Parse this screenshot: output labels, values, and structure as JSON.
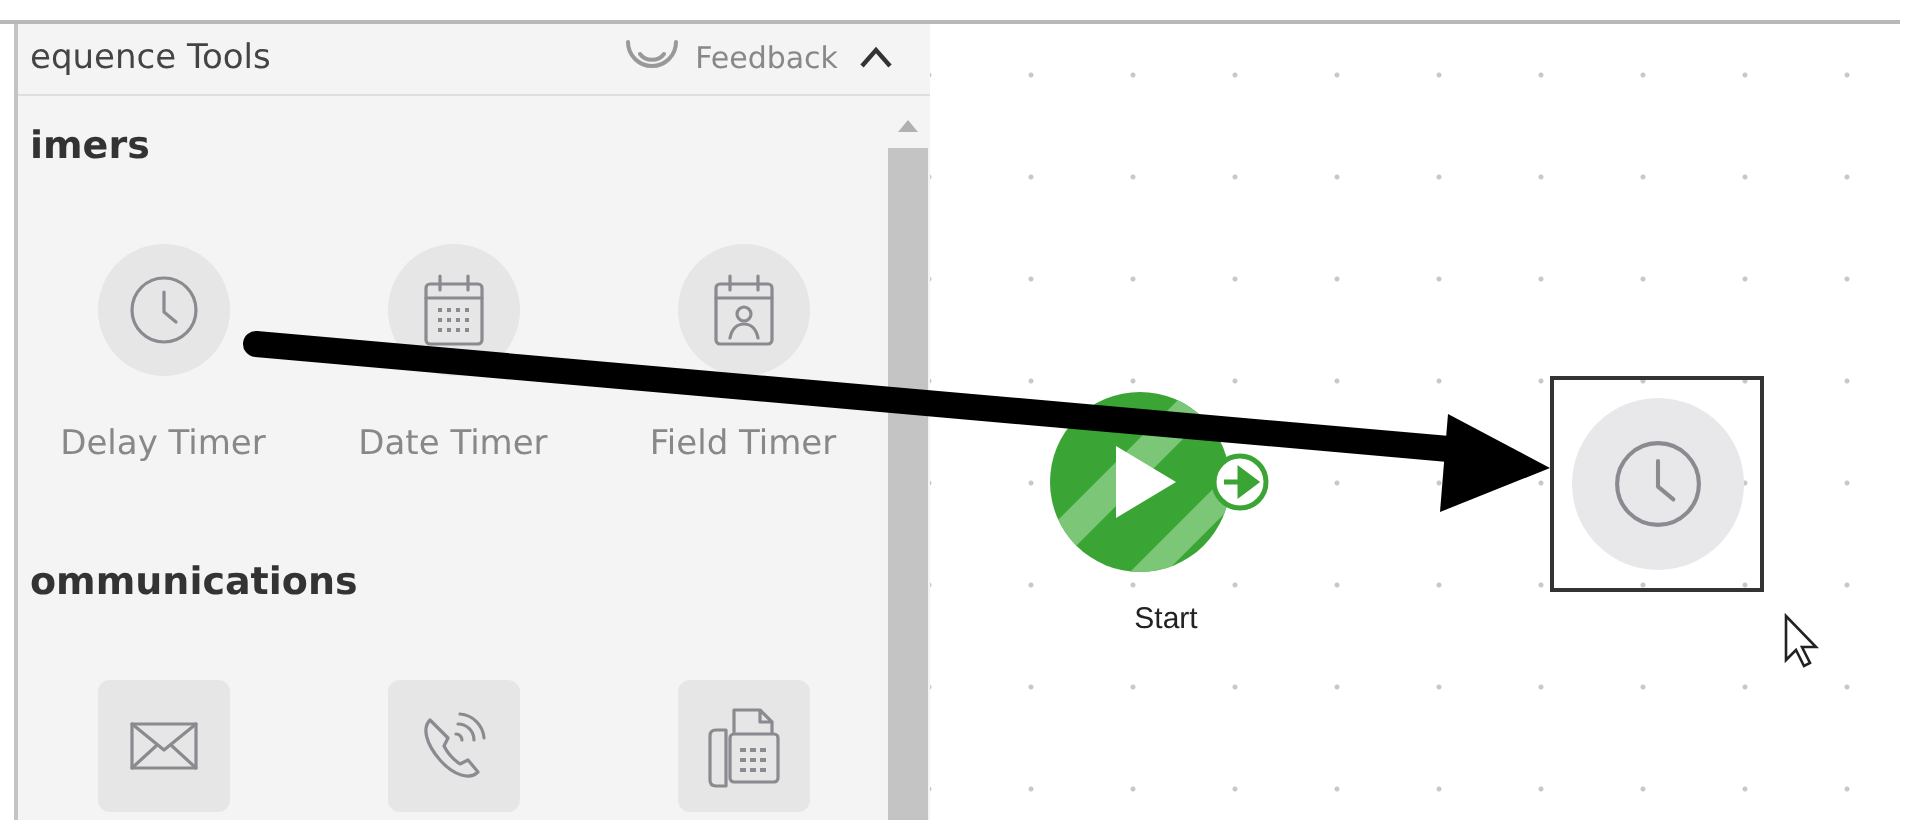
{
  "panel": {
    "title": "equence Tools",
    "feedback": "Feedback",
    "collapsed": false
  },
  "sections": [
    {
      "title": "imers",
      "tools": [
        {
          "kind": "delay",
          "label": "Delay Timer"
        },
        {
          "kind": "date",
          "label": "Date Timer"
        },
        {
          "kind": "field",
          "label": "Field Timer"
        }
      ]
    },
    {
      "title": "ommunications",
      "tools": [
        {
          "kind": "email"
        },
        {
          "kind": "call"
        },
        {
          "kind": "fax"
        }
      ]
    }
  ],
  "canvas": {
    "nodes": [
      {
        "kind": "start",
        "label": "Start"
      },
      {
        "kind": "delay",
        "selected": true
      }
    ]
  }
}
